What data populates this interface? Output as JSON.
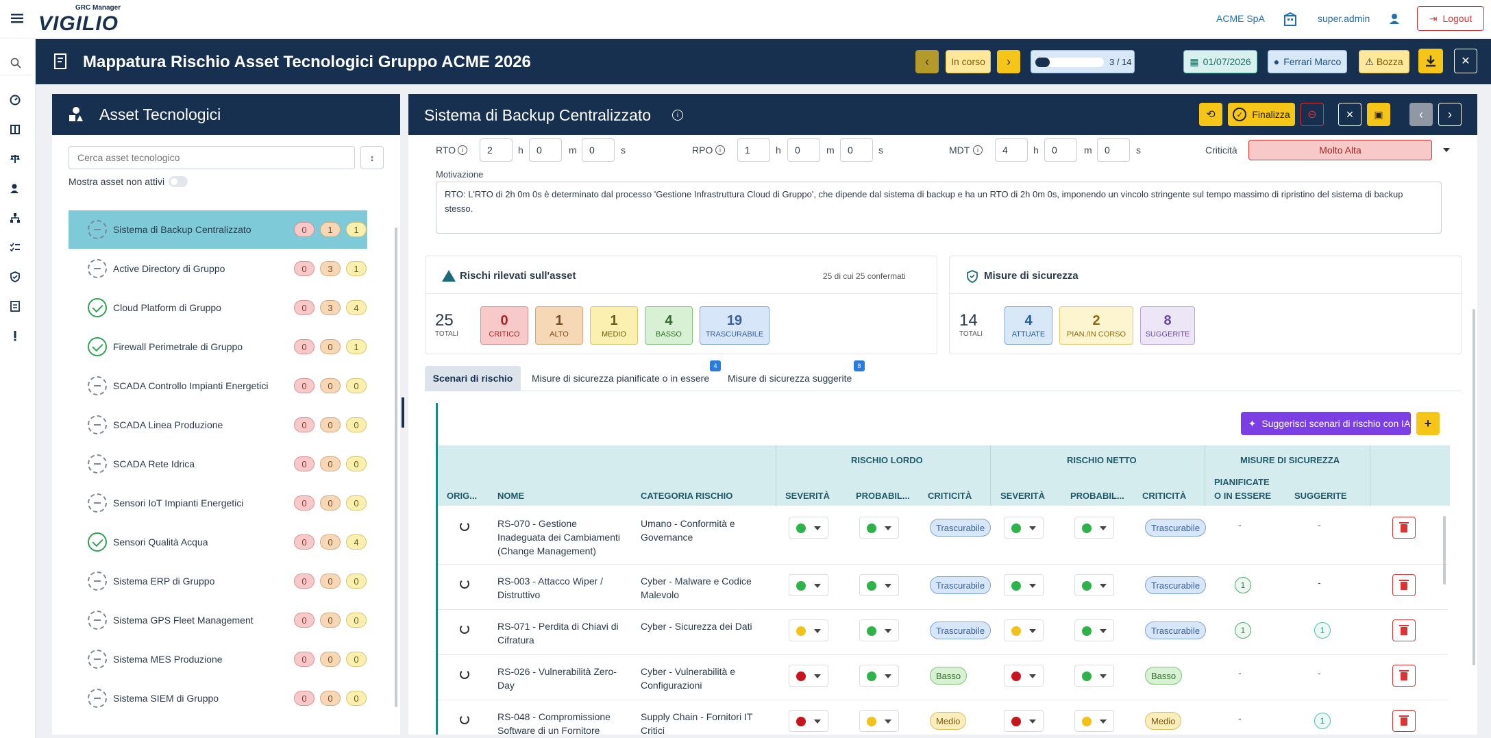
{
  "topbar": {
    "logo_small": "GRC Manager",
    "logo_text": "VIGILIO",
    "company": "ACME SpA",
    "user": "super.admin",
    "logout": "Logout"
  },
  "titlebar": {
    "title": "Mappatura Rischio Asset Tecnologici Gruppo ACME 2026",
    "status": "In corso",
    "progress_text": "3 / 14",
    "progress_value": 0.21,
    "date": "01/07/2026",
    "owner": "Ferrari Marco",
    "draft": "Bozza"
  },
  "left": {
    "title": "Asset Tecnologici",
    "search_placeholder": "Cerca asset tecnologico",
    "show_inactive": "Mostra asset non attivi",
    "assets": [
      {
        "name": "Sistema di Backup Centralizzato",
        "status": "dash",
        "c": [
          "0",
          "1",
          "1"
        ]
      },
      {
        "name": "Active Directory di Gruppo",
        "status": "dash",
        "c": [
          "0",
          "3",
          "1"
        ]
      },
      {
        "name": "Cloud Platform di Gruppo",
        "status": "ok",
        "c": [
          "0",
          "3",
          "4"
        ]
      },
      {
        "name": "Firewall Perimetrale di Gruppo",
        "status": "ok",
        "c": [
          "0",
          "0",
          "1"
        ]
      },
      {
        "name": "SCADA Controllo Impianti Energetici",
        "status": "dash",
        "c": [
          "0",
          "0",
          "0"
        ]
      },
      {
        "name": "SCADA Linea Produzione",
        "status": "dash",
        "c": [
          "0",
          "0",
          "0"
        ]
      },
      {
        "name": "SCADA Rete Idrica",
        "status": "dash",
        "c": [
          "0",
          "0",
          "0"
        ]
      },
      {
        "name": "Sensori IoT Impianti Energetici",
        "status": "dash",
        "c": [
          "0",
          "0",
          "0"
        ]
      },
      {
        "name": "Sensori Qualità Acqua",
        "status": "ok",
        "c": [
          "0",
          "0",
          "4"
        ]
      },
      {
        "name": "Sistema ERP di Gruppo",
        "status": "dash",
        "c": [
          "0",
          "0",
          "0"
        ]
      },
      {
        "name": "Sistema GPS Fleet Management",
        "status": "dash",
        "c": [
          "0",
          "0",
          "0"
        ]
      },
      {
        "name": "Sistema MES Produzione",
        "status": "dash",
        "c": [
          "0",
          "0",
          "0"
        ]
      },
      {
        "name": "Sistema SIEM di Gruppo",
        "status": "dash",
        "c": [
          "0",
          "0",
          "0"
        ]
      }
    ]
  },
  "right": {
    "title": "Sistema di Backup Centralizzato",
    "finalize": "Finalizza",
    "rto_label": "RTO",
    "rpo_label": "RPO",
    "mdt_label": "MDT",
    "criticality_label": "Criticità",
    "rto": [
      "2",
      "0",
      "0"
    ],
    "rpo": [
      "1",
      "0",
      "0"
    ],
    "mdt": [
      "4",
      "0",
      "0"
    ],
    "unit_h": "h",
    "unit_m": "m",
    "unit_s": "s",
    "criticality": "Molto Alta",
    "motivation_label": "Motivazione",
    "motivation": "RTO: L'RTO di 2h 0m 0s è determinato dal processo 'Gestione Infrastruttura Cloud di Gruppo', che dipende dal sistema di backup e ha un RTO di 2h 0m 0s, imponendo un vincolo stringente sul tempo massimo di ripristino del sistema di backup stesso.",
    "risks": {
      "title": "Rischi rilevati sull'asset",
      "summary": "25 di cui 25 confermati",
      "total": "25",
      "total_label": "TOTALI",
      "critico": "0",
      "critico_label": "CRITICO",
      "alto": "1",
      "alto_label": "ALTO",
      "medio": "1",
      "medio_label": "MEDIO",
      "basso": "4",
      "basso_label": "BASSO",
      "trascurabile": "19",
      "trascurabile_label": "TRASCURABILE"
    },
    "measures": {
      "title": "Misure di sicurezza",
      "total": "14",
      "total_label": "TOTALI",
      "attuate": "4",
      "attuate_label": "ATTUATE",
      "pian": "2",
      "pian_label": "PIAN./IN CORSO",
      "sugg": "8",
      "sugg_label": "SUGGERITE"
    },
    "tabs": [
      {
        "label": "Scenari di rischio"
      },
      {
        "label": "Misure di sicurezza pianificate o in essere",
        "badge": "4"
      },
      {
        "label": "Misure di sicurezza suggerite",
        "badge": "8"
      }
    ],
    "ai_button": "Suggerisci scenari di rischio con IA",
    "table": {
      "group_lordo": "RISCHIO LORDO",
      "group_netto": "RISCHIO NETTO",
      "group_misure": "MISURE DI SICUREZZA",
      "col_orig": "ORIG...",
      "col_nome": "NOME",
      "col_cat": "CATEGORIA RISCHIO",
      "col_sev": "SEVERITÀ",
      "col_prob": "PROBABIL...",
      "col_crit": "CRITICITÀ",
      "col_pian1": "PIANIFICATE",
      "col_pian2": "O IN ESSERE",
      "col_sugg": "SUGGERITE",
      "rows": [
        {
          "nome": [
            "RS-070 - Gestione",
            "Inadeguata dei Cambiamenti",
            "(Change Management)"
          ],
          "cat": [
            "Umano - Conformità e",
            "Governance"
          ],
          "ls": "#2db34a",
          "lp": "#2db34a",
          "lc": "Trascurabile",
          "ns": "#2db34a",
          "np": "#2db34a",
          "nc": "Trascurabile",
          "pian": "-",
          "sugg": "-"
        },
        {
          "nome": [
            "RS-003 - Attacco Wiper /",
            "Distruttivo"
          ],
          "cat": [
            "Cyber - Malware e Codice",
            "Malevolo"
          ],
          "ls": "#2db34a",
          "lp": "#2db34a",
          "lc": "Trascurabile",
          "ns": "#2db34a",
          "np": "#2db34a",
          "nc": "Trascurabile",
          "pian": "1",
          "sugg": "-"
        },
        {
          "nome": [
            "RS-071 - Perdita di Chiavi di",
            "Cifratura"
          ],
          "cat": [
            "Cyber - Sicurezza dei Dati"
          ],
          "ls": "#f2c21b",
          "lp": "#2db34a",
          "lc": "Trascurabile",
          "ns": "#f2c21b",
          "np": "#2db34a",
          "nc": "Trascurabile",
          "pian": "1",
          "sugg": "1"
        },
        {
          "nome": [
            "RS-026 - Vulnerabilità Zero-",
            "Day"
          ],
          "cat": [
            "Cyber - Vulnerabilità e",
            "Configurazioni"
          ],
          "ls": "#c8141d",
          "lp": "#2db34a",
          "lc": "Basso",
          "ns": "#c8141d",
          "np": "#2db34a",
          "nc": "Basso",
          "pian": "-",
          "sugg": "-"
        },
        {
          "nome": [
            "RS-048 - Compromissione",
            "Software di un Fornitore"
          ],
          "cat": [
            "Supply Chain - Fornitori IT",
            "Critici"
          ],
          "ls": "#c8141d",
          "lp": "#f2c21b",
          "lc": "Medio",
          "ns": "#c8141d",
          "np": "#f2c21b",
          "nc": "Medio",
          "pian": "-",
          "sugg": "1"
        }
      ]
    }
  }
}
